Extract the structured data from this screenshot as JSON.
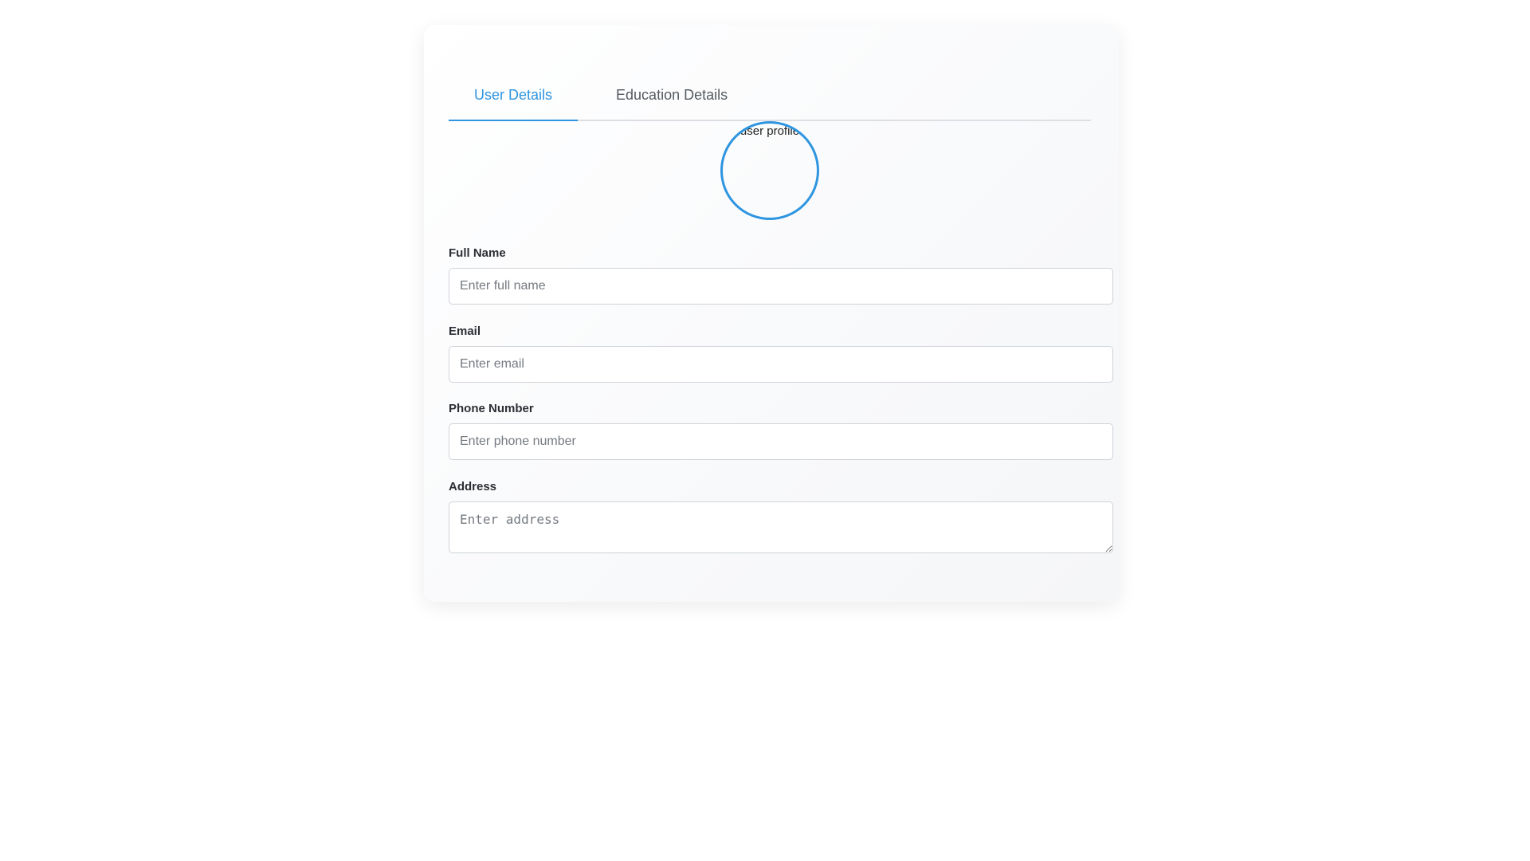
{
  "tabs": [
    {
      "label": "User Details",
      "active": true
    },
    {
      "label": "Education Details",
      "active": false
    }
  ],
  "avatar": {
    "alt_text": "user profile"
  },
  "form": {
    "full_name": {
      "label": "Full Name",
      "placeholder": "Enter full name",
      "value": ""
    },
    "email": {
      "label": "Email",
      "placeholder": "Enter email",
      "value": ""
    },
    "phone": {
      "label": "Phone Number",
      "placeholder": "Enter phone number",
      "value": ""
    },
    "address": {
      "label": "Address",
      "placeholder": "Enter address",
      "value": ""
    }
  },
  "colors": {
    "accent": "#2e95e0",
    "tab_inactive": "#555a60",
    "border": "#cfd3d8"
  }
}
